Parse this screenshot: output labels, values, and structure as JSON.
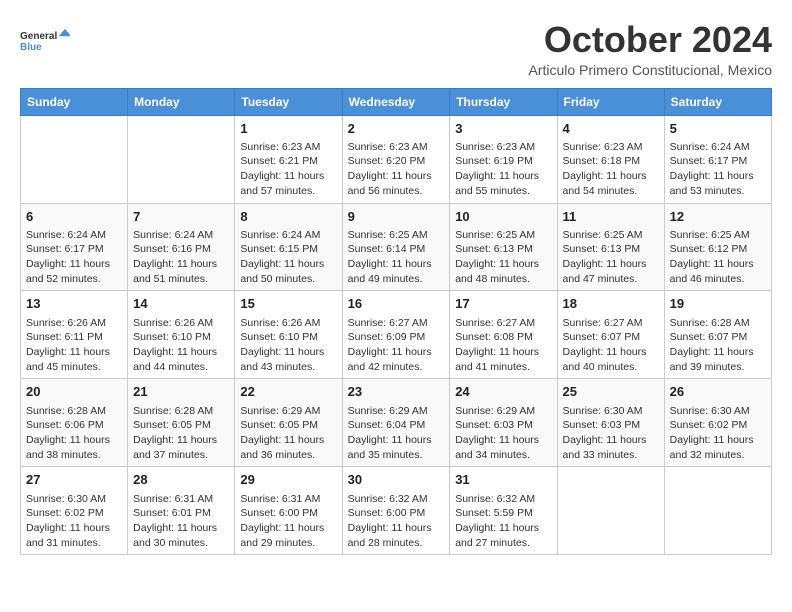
{
  "logo": {
    "line1": "General",
    "line2": "Blue"
  },
  "header": {
    "title": "October 2024",
    "subtitle": "Articulo Primero Constitucional, Mexico"
  },
  "days_of_week": [
    "Sunday",
    "Monday",
    "Tuesday",
    "Wednesday",
    "Thursday",
    "Friday",
    "Saturday"
  ],
  "weeks": [
    [
      {
        "day": "",
        "info": ""
      },
      {
        "day": "",
        "info": ""
      },
      {
        "day": "1",
        "info": "Sunrise: 6:23 AM\nSunset: 6:21 PM\nDaylight: 11 hours and 57 minutes."
      },
      {
        "day": "2",
        "info": "Sunrise: 6:23 AM\nSunset: 6:20 PM\nDaylight: 11 hours and 56 minutes."
      },
      {
        "day": "3",
        "info": "Sunrise: 6:23 AM\nSunset: 6:19 PM\nDaylight: 11 hours and 55 minutes."
      },
      {
        "day": "4",
        "info": "Sunrise: 6:23 AM\nSunset: 6:18 PM\nDaylight: 11 hours and 54 minutes."
      },
      {
        "day": "5",
        "info": "Sunrise: 6:24 AM\nSunset: 6:17 PM\nDaylight: 11 hours and 53 minutes."
      }
    ],
    [
      {
        "day": "6",
        "info": "Sunrise: 6:24 AM\nSunset: 6:17 PM\nDaylight: 11 hours and 52 minutes."
      },
      {
        "day": "7",
        "info": "Sunrise: 6:24 AM\nSunset: 6:16 PM\nDaylight: 11 hours and 51 minutes."
      },
      {
        "day": "8",
        "info": "Sunrise: 6:24 AM\nSunset: 6:15 PM\nDaylight: 11 hours and 50 minutes."
      },
      {
        "day": "9",
        "info": "Sunrise: 6:25 AM\nSunset: 6:14 PM\nDaylight: 11 hours and 49 minutes."
      },
      {
        "day": "10",
        "info": "Sunrise: 6:25 AM\nSunset: 6:13 PM\nDaylight: 11 hours and 48 minutes."
      },
      {
        "day": "11",
        "info": "Sunrise: 6:25 AM\nSunset: 6:13 PM\nDaylight: 11 hours and 47 minutes."
      },
      {
        "day": "12",
        "info": "Sunrise: 6:25 AM\nSunset: 6:12 PM\nDaylight: 11 hours and 46 minutes."
      }
    ],
    [
      {
        "day": "13",
        "info": "Sunrise: 6:26 AM\nSunset: 6:11 PM\nDaylight: 11 hours and 45 minutes."
      },
      {
        "day": "14",
        "info": "Sunrise: 6:26 AM\nSunset: 6:10 PM\nDaylight: 11 hours and 44 minutes."
      },
      {
        "day": "15",
        "info": "Sunrise: 6:26 AM\nSunset: 6:10 PM\nDaylight: 11 hours and 43 minutes."
      },
      {
        "day": "16",
        "info": "Sunrise: 6:27 AM\nSunset: 6:09 PM\nDaylight: 11 hours and 42 minutes."
      },
      {
        "day": "17",
        "info": "Sunrise: 6:27 AM\nSunset: 6:08 PM\nDaylight: 11 hours and 41 minutes."
      },
      {
        "day": "18",
        "info": "Sunrise: 6:27 AM\nSunset: 6:07 PM\nDaylight: 11 hours and 40 minutes."
      },
      {
        "day": "19",
        "info": "Sunrise: 6:28 AM\nSunset: 6:07 PM\nDaylight: 11 hours and 39 minutes."
      }
    ],
    [
      {
        "day": "20",
        "info": "Sunrise: 6:28 AM\nSunset: 6:06 PM\nDaylight: 11 hours and 38 minutes."
      },
      {
        "day": "21",
        "info": "Sunrise: 6:28 AM\nSunset: 6:05 PM\nDaylight: 11 hours and 37 minutes."
      },
      {
        "day": "22",
        "info": "Sunrise: 6:29 AM\nSunset: 6:05 PM\nDaylight: 11 hours and 36 minutes."
      },
      {
        "day": "23",
        "info": "Sunrise: 6:29 AM\nSunset: 6:04 PM\nDaylight: 11 hours and 35 minutes."
      },
      {
        "day": "24",
        "info": "Sunrise: 6:29 AM\nSunset: 6:03 PM\nDaylight: 11 hours and 34 minutes."
      },
      {
        "day": "25",
        "info": "Sunrise: 6:30 AM\nSunset: 6:03 PM\nDaylight: 11 hours and 33 minutes."
      },
      {
        "day": "26",
        "info": "Sunrise: 6:30 AM\nSunset: 6:02 PM\nDaylight: 11 hours and 32 minutes."
      }
    ],
    [
      {
        "day": "27",
        "info": "Sunrise: 6:30 AM\nSunset: 6:02 PM\nDaylight: 11 hours and 31 minutes."
      },
      {
        "day": "28",
        "info": "Sunrise: 6:31 AM\nSunset: 6:01 PM\nDaylight: 11 hours and 30 minutes."
      },
      {
        "day": "29",
        "info": "Sunrise: 6:31 AM\nSunset: 6:00 PM\nDaylight: 11 hours and 29 minutes."
      },
      {
        "day": "30",
        "info": "Sunrise: 6:32 AM\nSunset: 6:00 PM\nDaylight: 11 hours and 28 minutes."
      },
      {
        "day": "31",
        "info": "Sunrise: 6:32 AM\nSunset: 5:59 PM\nDaylight: 11 hours and 27 minutes."
      },
      {
        "day": "",
        "info": ""
      },
      {
        "day": "",
        "info": ""
      }
    ]
  ]
}
